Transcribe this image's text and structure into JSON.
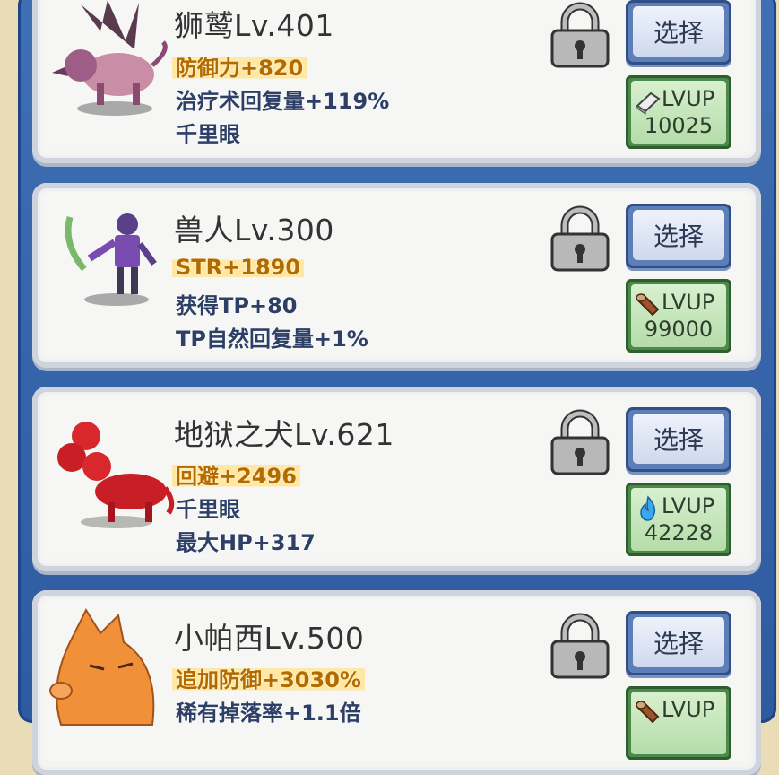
{
  "units": [
    {
      "name": "狮鹫Lv.401",
      "highlight_stat": "防御力+820",
      "stats": [
        "治疗术回复量+119%",
        "千里眼"
      ],
      "select_label": "选择",
      "lvup_label": "LVUP",
      "lvup_cost": "10025",
      "lvup_icon": "whetstone-icon",
      "portrait": "griffin-portrait"
    },
    {
      "name": "兽人Lv.300",
      "highlight_stat": "STR+1890",
      "stats": [
        "获得TP+80",
        "TP自然回复量+1%"
      ],
      "select_label": "选择",
      "lvup_label": "LVUP",
      "lvup_cost": "99000",
      "lvup_icon": "log-icon",
      "portrait": "orc-portrait"
    },
    {
      "name": "地狱之犬Lv.621",
      "highlight_stat": "回避+2496",
      "stats": [
        "千里眼",
        "最大HP+317"
      ],
      "select_label": "选择",
      "lvup_label": "LVUP",
      "lvup_cost": "42228",
      "lvup_icon": "blue-flame-icon",
      "portrait": "cerberus-portrait"
    },
    {
      "name": "小帕西Lv.500",
      "highlight_stat": "追加防御+3030%",
      "stats": [
        "稀有掉落率+1.1倍"
      ],
      "select_label": "选择",
      "lvup_label": "LVUP",
      "lvup_cost": "",
      "lvup_icon": "log-icon",
      "portrait": "wolf-portrait"
    }
  ],
  "colors": {
    "frame_blue": "#3f6fb4",
    "card_bg": "#f4f4f2",
    "highlight_text": "#b36b00",
    "highlight_bg": "#ffe8a3",
    "stat_text": "#2d3f66",
    "lvup_green": "#4b8a4a",
    "select_blue": "#5d7fb8"
  }
}
